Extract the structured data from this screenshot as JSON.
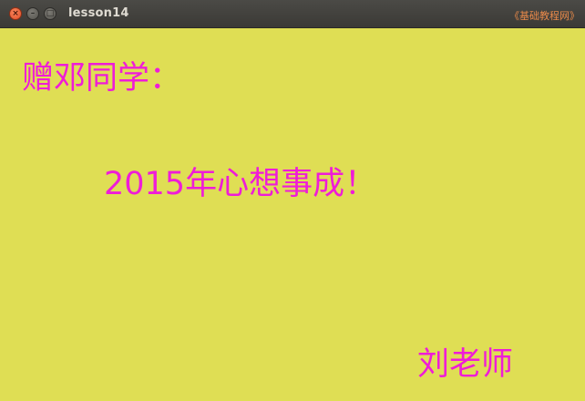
{
  "window": {
    "title": "lesson14",
    "watermark": "《基础教程网》",
    "buttons": {
      "close_glyph": "×",
      "minimize_glyph": "–",
      "maximize_glyph": "□"
    }
  },
  "content": {
    "greeting": "赠邓同学：",
    "wish": "2015年心想事成！",
    "signature": "刘老师"
  },
  "colors": {
    "background": "#dfde54",
    "text": "#ef1cd8",
    "titlebar": "#3c3b37"
  }
}
